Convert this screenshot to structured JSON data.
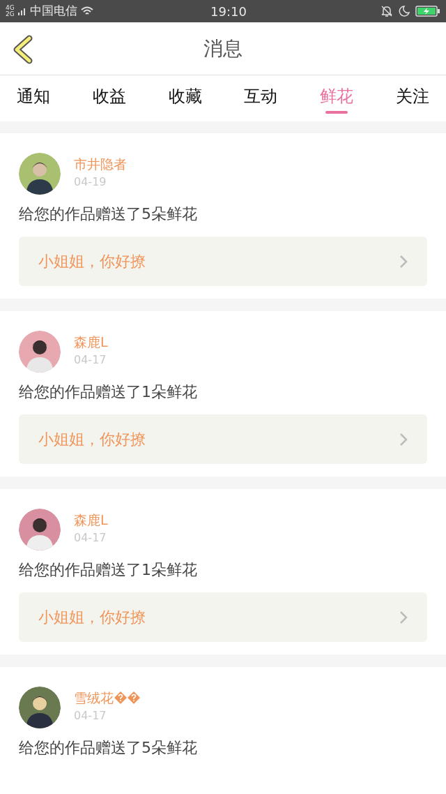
{
  "status_bar": {
    "network_top": "4G",
    "network_bottom": "2G",
    "carrier": "中国电信",
    "time": "19:10"
  },
  "header": {
    "title": "消息"
  },
  "tabs": [
    {
      "label": "通知",
      "selected": false
    },
    {
      "label": "收益",
      "selected": false
    },
    {
      "label": "收藏",
      "selected": false
    },
    {
      "label": "互动",
      "selected": false
    },
    {
      "label": "鲜花",
      "selected": true
    },
    {
      "label": "关注",
      "selected": false
    }
  ],
  "messages": [
    {
      "name": "市井隐者",
      "date": "04-19",
      "text": "给您的作品赠送了5朵鲜花",
      "quote": "小姐姐，你好撩"
    },
    {
      "name": "森鹿L",
      "date": "04-17",
      "text": "给您的作品赠送了1朵鲜花",
      "quote": "小姐姐，你好撩"
    },
    {
      "name": "森鹿L",
      "date": "04-17",
      "text": "给您的作品赠送了1朵鲜花",
      "quote": "小姐姐，你好撩"
    },
    {
      "name": "雪绒花",
      "name_marks": [
        {
          "kind": "missing-glyph"
        },
        {
          "kind": "missing-glyph"
        }
      ],
      "date": "04-17",
      "text": "给您的作品赠送了5朵鲜花"
    }
  ]
}
